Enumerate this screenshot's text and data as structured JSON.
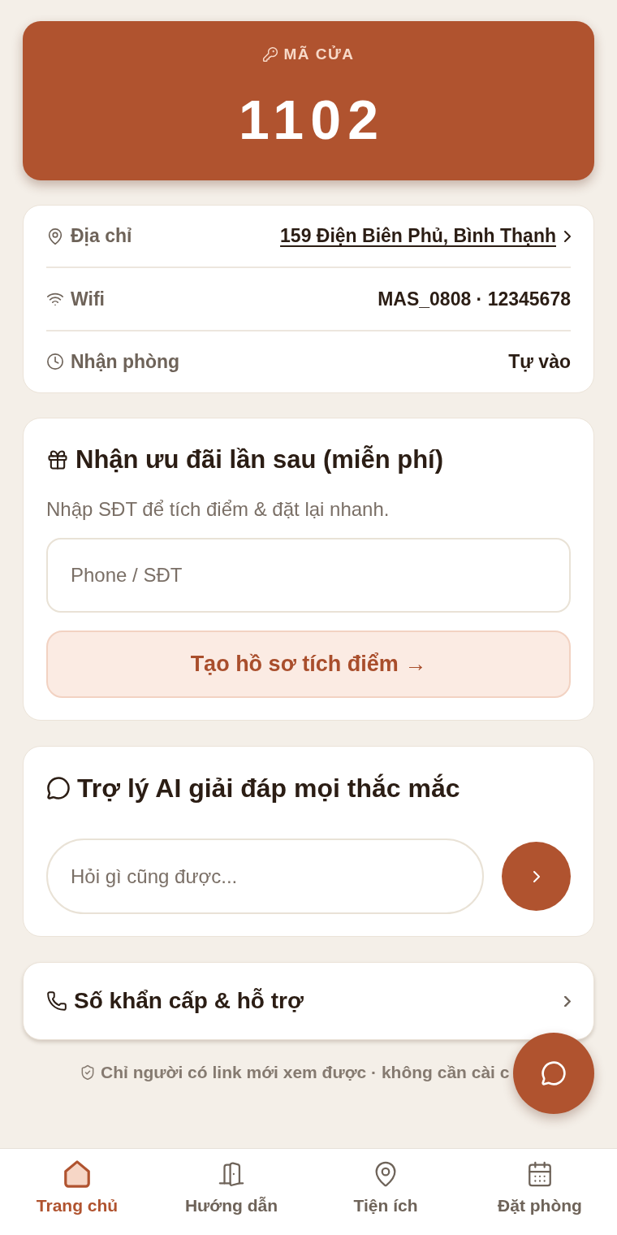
{
  "door_code": {
    "label": "MÃ CỬA",
    "code": "1102"
  },
  "info": [
    {
      "kind": "link",
      "label": "Địa chỉ",
      "value": "159 Điện Biên Phủ, Bình Thạnh"
    },
    {
      "kind": "text",
      "label": "Wifi",
      "value": "MAS_0808 · 12345678"
    },
    {
      "kind": "text",
      "label": "Nhận phòng",
      "value": "Tự vào"
    }
  ],
  "loyalty": {
    "title": "Nhận ưu đãi lần sau (miễn phí)",
    "subtitle": "Nhập SĐT để tích điểm & đặt lại nhanh.",
    "phone_field": {
      "placeholder": "Phone / SĐT"
    },
    "button": "Tạo hồ sơ tích điểm →"
  },
  "assistant": {
    "title": "Trợ lý AI giải đáp mọi thắc mắc",
    "question_field": {
      "placeholder": "Hỏi gì cũng được..."
    }
  },
  "emergency": {
    "label": "Số khẩn cấp & hỗ trợ"
  },
  "privacy_note": "Chỉ người có link mới xem được · không cần cài c",
  "bottom_nav": [
    {
      "label": "Trang chủ",
      "selected": true
    },
    {
      "label": "Hướng dẫn",
      "selected": false
    },
    {
      "label": "Tiện ích",
      "selected": false
    },
    {
      "label": "Đặt phòng",
      "selected": false
    }
  ]
}
